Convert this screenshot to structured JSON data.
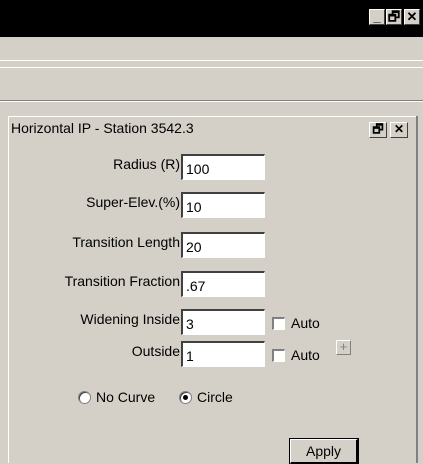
{
  "window": {
    "minimize_glyph": "_",
    "restore_glyph": "🗗",
    "close_glyph": "✕"
  },
  "panel": {
    "title": "Horizontal IP - Station 3542.3",
    "restore_glyph": "🗗",
    "close_glyph": "✕"
  },
  "fields": {
    "radius": {
      "label": "Radius (R)",
      "value": "100"
    },
    "super_elev": {
      "label": "Super-Elev.(%)",
      "value": "10"
    },
    "transition_length": {
      "label": "Transition Length",
      "value": "20"
    },
    "transition_fraction": {
      "label": "Transition Fraction",
      "value": ".67"
    },
    "widening_inside": {
      "label": "Widening Inside",
      "value": "3",
      "auto_label": "Auto",
      "auto_checked": false
    },
    "widening_outside": {
      "label": "Outside",
      "value": "1",
      "auto_label": "Auto",
      "auto_checked": false
    }
  },
  "plus_glyph": "+",
  "curve": {
    "options": [
      "No Curve",
      "Circle"
    ],
    "selected": "Circle"
  },
  "apply_label": "Apply"
}
